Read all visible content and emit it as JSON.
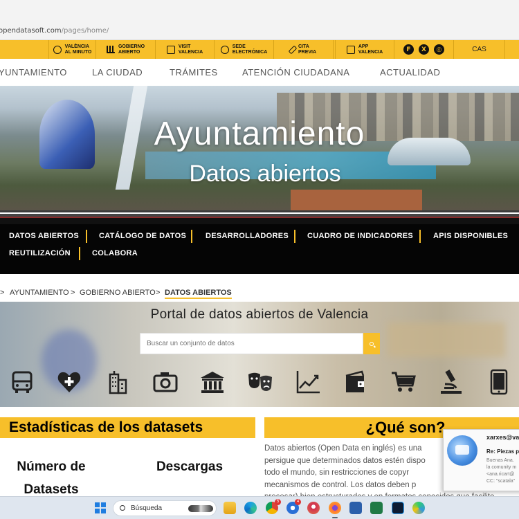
{
  "browser": {
    "url_host": "opendatasoft.com",
    "url_path": "/pages/home/"
  },
  "topbar": {
    "items": [
      {
        "icon": "clock-icon",
        "label": "VALÈNCIA AL MINUTO",
        "l1": "VALÈNCIA",
        "l2": "AL MINUTO"
      },
      {
        "icon": "building-icon",
        "label": "GOBIERNO ABIERTO",
        "l1": "GOBIERNO",
        "l2": "ABIERTO"
      },
      {
        "icon": "map-icon",
        "label": "VISIT VALENCIA",
        "l1": "VISIT",
        "l2": "VALENCIA"
      },
      {
        "icon": "shield-icon",
        "label": "SEDE ELECTRÓNICA",
        "l1": "SEDE",
        "l2": "ELECTRÓNICA"
      },
      {
        "icon": "pencil-icon",
        "label": "CITA PREVIA",
        "l1": "CITA",
        "l2": "PREVIA"
      },
      {
        "icon": "app-icon",
        "label": "APP VALENCIA",
        "l1": "APP",
        "l2": "VALENCIA"
      }
    ],
    "social": [
      "f",
      "X",
      "◎"
    ],
    "lang": "CAS"
  },
  "mainnav": [
    "YUNTAMIENTO",
    "LA CIUDAD",
    "TRÁMITES",
    "ATENCIÓN CIUDADANA",
    "ACTUALIDAD"
  ],
  "hero": {
    "title": "Ayuntamiento",
    "subtitle": "Datos abiertos"
  },
  "subnav": [
    "DATOS ABIERTOS",
    "CATÁLOGO DE DATOS",
    "DESARROLLADORES",
    "CUADRO DE INDICADORES",
    "APIS DISPONIBLES",
    "REUTILIZACIÓN",
    "COLABORA"
  ],
  "breadcrumb": {
    "sep": ">",
    "items": [
      "AYUNTAMIENTO",
      "GOBIERNO ABIERTO",
      "DATOS ABIERTOS"
    ]
  },
  "portal": {
    "title": "Portal de datos abiertos de Valencia",
    "search_placeholder": "Buscar un conjunto de datos",
    "categories": [
      "bus-icon",
      "health-icon",
      "building-icon",
      "camera-icon",
      "government-icon",
      "theater-masks-icon",
      "chart-line-icon",
      "wallet-icon",
      "cart-icon",
      "microscope-icon",
      "tablet-icon"
    ]
  },
  "stats": {
    "title": "Estadísticas de los datasets",
    "datasets_l1": "Número de",
    "datasets_l2": "Datasets",
    "downloads_label": "Descargas"
  },
  "what": {
    "title": "¿Qué son?",
    "lines": [
      "Datos abiertos (Open Data en inglés) es una",
      "persigue que determinados datos estén dispo",
      "todo el mundo, sin restricciones de copyr",
      "mecanismos de control. Los datos deben p",
      "procesar) bien estructurados y en formatos conocidos que facilite"
    ]
  },
  "notification": {
    "from": "xarxes@val",
    "subject": "Re: Piezas pa",
    "body": [
      "Buenas Ana.",
      "la comunity m",
      "<ana.ricart@",
      "CC: \"scatala\""
    ]
  },
  "taskbar": {
    "search_label": "Búsqueda",
    "badges": [
      "5",
      "4"
    ]
  },
  "colors": {
    "accent": "#f7bf2a",
    "dark": "#050505"
  }
}
